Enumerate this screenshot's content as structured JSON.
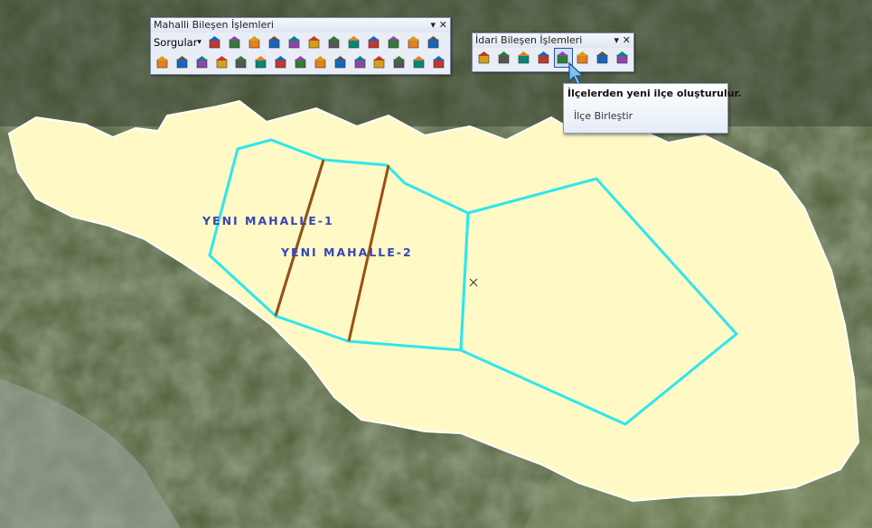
{
  "map": {
    "labels": [
      {
        "text": "YENI MAHALLE-1",
        "name": "neighborhood-label-1"
      },
      {
        "text": "YENI MAHALLE-2",
        "name": "neighborhood-label-2"
      }
    ],
    "colors": {
      "district_fill": "#fff9c6",
      "boundary": "#2ee6ee",
      "divider": "#9b4f12",
      "label": "#3645b5"
    }
  },
  "toolbar_mahalli": {
    "title": "Mahalli Bileşen İşlemleri",
    "dropdown_label": "Sorgular",
    "row1_icons": [
      "camera-icon",
      "terrain-icon",
      "terrain-icon-2",
      "edit-line-icon",
      "ruler-icon",
      "stn-icon",
      "search-map-icon",
      "hand-tool-icon",
      "house-icon",
      "house-edit-icon",
      "house-delete-icon",
      "house-grid-icon"
    ],
    "row2_icons": [
      "parcel-tool-icon",
      "merge-parcel-icon",
      "house-add-icon",
      "building-icon",
      "move-icon",
      "split-icon",
      "join-icon",
      "anchor-icon",
      "node-icon",
      "line-edit-icon",
      "line-add-icon",
      "attribute-icon",
      "measure-icon",
      "bucket-icon",
      "info-bubble-icon"
    ]
  },
  "toolbar_idari": {
    "title": "İdari Bileşen İşlemleri",
    "icons": [
      "edit-area-icon",
      "draw-boundary-icon",
      "pencil-icon",
      "paint-icon",
      "create-district-icon",
      "hand-icon",
      "grid-icon",
      "gear-globe-icon"
    ],
    "active_icon_index": 4
  },
  "tooltip": {
    "title": "İlçelerden yeni ilçe oluşturulur.",
    "item": "İlçe Birleştir"
  }
}
